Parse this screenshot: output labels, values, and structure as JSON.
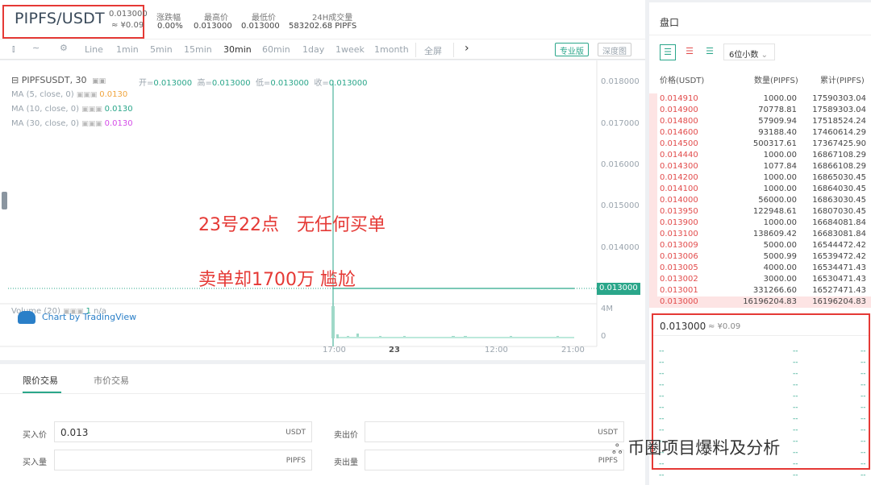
{
  "header": {
    "pair": "PIPFS/USDT",
    "price": "0.013000",
    "price_cny": "≈ ¥0.09",
    "stats": [
      {
        "label": "涨跌幅",
        "value": "0.00%"
      },
      {
        "label": "最高价",
        "value": "0.013000"
      },
      {
        "label": "最低价",
        "value": "0.013000"
      },
      {
        "label": "24H成交量",
        "value": "583202.68 PIPFS"
      }
    ]
  },
  "toolbar": {
    "intervals": [
      "Line",
      "1min",
      "5min",
      "15min",
      "30min",
      "60min",
      "1day",
      "1week",
      "1month"
    ],
    "active_interval": "30min",
    "fullscreen": "全屏",
    "pro_button": "专业版",
    "depth_button": "深度图"
  },
  "chart": {
    "symbol_line": "PIPFSUSDT, 30",
    "ohlc": [
      {
        "k": "开=",
        "v": "0.013000"
      },
      {
        "k": "高=",
        "v": "0.013000"
      },
      {
        "k": "低=",
        "v": "0.013000"
      },
      {
        "k": "收=",
        "v": "0.013000"
      }
    ],
    "ma": [
      {
        "label": "MA (5, close, 0)",
        "value": "0.0130",
        "color": "#f0a43c"
      },
      {
        "label": "MA (10, close, 0)",
        "value": "0.0130",
        "color": "#2aa68a"
      },
      {
        "label": "MA (30, close, 0)",
        "value": "0.0130",
        "color": "#d44ce8"
      }
    ],
    "volume_legend": "Volume (20)",
    "volume_value": "1",
    "volume_na": "n/a",
    "watermark": "Chart by TradingView",
    "price_axis": [
      "0.018000",
      "0.017000",
      "0.016000",
      "0.015000",
      "0.014000"
    ],
    "current_price": "0.013000",
    "volume_axis": [
      "4M",
      "0"
    ],
    "time_axis": [
      "17:00",
      "23",
      "12:00",
      "21:00"
    ],
    "annotation_1": "23号22点　无任何买单",
    "annotation_2": "卖单却1700万  尴尬"
  },
  "trade": {
    "tabs": [
      "限价交易",
      "市价交易"
    ],
    "buy_price_label": "买入价",
    "buy_price_value": "0.013",
    "buy_price_unit": "USDT",
    "buy_amount_label": "买入量",
    "buy_amount_unit": "PIPFS",
    "sell_price_label": "卖出价",
    "sell_price_unit": "USDT",
    "sell_amount_label": "卖出量",
    "sell_amount_unit": "PIPFS"
  },
  "orderbook": {
    "title": "盘口",
    "decimals": "6位小数",
    "col_price": "价格(USDT)",
    "col_amount": "数量(PIPFS)",
    "col_total": "累计(PIPFS)",
    "asks": [
      [
        "0.014910",
        "1000.00",
        "17590303.04"
      ],
      [
        "0.014900",
        "70778.81",
        "17589303.04"
      ],
      [
        "0.014800",
        "57909.94",
        "17518524.24"
      ],
      [
        "0.014600",
        "93188.40",
        "17460614.29"
      ],
      [
        "0.014500",
        "500317.61",
        "17367425.90"
      ],
      [
        "0.014440",
        "1000.00",
        "16867108.29"
      ],
      [
        "0.014300",
        "1077.84",
        "16866108.29"
      ],
      [
        "0.014200",
        "1000.00",
        "16865030.45"
      ],
      [
        "0.014100",
        "1000.00",
        "16864030.45"
      ],
      [
        "0.014000",
        "56000.00",
        "16863030.45"
      ],
      [
        "0.013950",
        "122948.61",
        "16807030.45"
      ],
      [
        "0.013900",
        "1000.00",
        "16684081.84"
      ],
      [
        "0.013100",
        "138609.42",
        "16683081.84"
      ],
      [
        "0.013009",
        "5000.00",
        "16544472.42"
      ],
      [
        "0.013006",
        "5000.99",
        "16539472.42"
      ],
      [
        "0.013005",
        "4000.00",
        "16534471.43"
      ],
      [
        "0.013002",
        "3000.00",
        "16530471.43"
      ],
      [
        "0.013001",
        "331266.60",
        "16527471.43"
      ],
      [
        "0.013000",
        "16196204.83",
        "16196204.83"
      ]
    ],
    "last_price": "0.013000",
    "last_price_cny": "≈ ¥0.09",
    "bid_placeholder": "--"
  },
  "watermark_overlay": "币圈项目爆料及分析",
  "colors": {
    "accent": "#2aa68a",
    "ask": "#e24c4c",
    "highlight_box": "#e53935"
  }
}
